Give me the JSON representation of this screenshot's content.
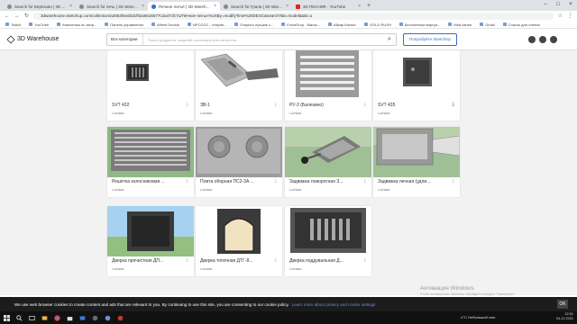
{
  "browser": {
    "tabs": [
      {
        "title": "Search for Берёзово | 3D Wareh",
        "icon": "sketchup",
        "active": false
      },
      {
        "title": "Search for печь | 3D Warehouse",
        "icon": "sketchup",
        "active": false
      },
      {
        "title": "Печное литьё | 3D Warehous",
        "icon": "sketchup",
        "active": true
      },
      {
        "title": "Search for Грали | 3D Warehouse",
        "icon": "sketchup",
        "active": false
      },
      {
        "title": "3D ПЕСНИК - YouTube",
        "icon": "youtube",
        "active": false
      }
    ],
    "new_tab": "+",
    "url": "3dwarehouse.sketchup.com/collection/a2853f4ed0d1f92a6516577c2a47cfc7u/Печное-литье?sortBy=modifyTime%20DESC&searchTab=model&tab=u",
    "bookmarks": [
      "Twitch",
      "YouTube",
      "Аналитика по запр...",
      "Панель управления",
      "Wheel Decide",
      "NPCGGC - отправ...",
      "Открыть лучшие к...",
      "ForceDrop - Магаз...",
      "Айкар Каснот",
      "GOLD RUSH",
      "Бесплатные виртуа...",
      "Мой канал",
      "Gmail",
      "Список для чтения"
    ]
  },
  "header": {
    "logo": "3D Warehouse",
    "category": "Все категории",
    "search_placeholder": "Поиск продуктов, моделей, коллекций или каталогов",
    "try_button": "Попробуйте SketchUp"
  },
  "cards": [
    {
      "title": "SVT 432",
      "author": "Luchtaar",
      "thumb": "door-small",
      "highlight": false
    },
    {
      "title": "ЗВ-1",
      "author": "Luchtaar",
      "thumb": "damper",
      "highlight": false
    },
    {
      "title": "РУ-2 (Балезино)",
      "author": "Luchtaar",
      "thumb": "grate",
      "highlight": false
    },
    {
      "title": "SVT 435",
      "author": "Luchtaar",
      "thumb": "door-square",
      "highlight": true
    },
    {
      "title": "Решётка колосниковая ...",
      "author": "Luchtaar",
      "thumb": "grate-green",
      "highlight": false
    },
    {
      "title": "Плита оборная ПС2-3А ...",
      "author": "Luchtaar",
      "thumb": "hob",
      "highlight": false
    },
    {
      "title": "Задвижка поворотная З...",
      "author": "Luchtaar",
      "thumb": "rotary",
      "highlight": false
    },
    {
      "title": "Задвижка печная (удли...",
      "author": "Luchtaar",
      "thumb": "damper-long",
      "highlight": false
    },
    {
      "title": "Дверка прочистная ДП...",
      "author": "Luchtaar",
      "thumb": "door-clean",
      "highlight": false
    },
    {
      "title": "Дверка топочная ДТГ-8...",
      "author": "Luchtaar",
      "thumb": "door-fire",
      "highlight": false
    },
    {
      "title": "Дверка поддувальная Д...",
      "author": "Luchtaar",
      "thumb": "door-ash",
      "highlight": false
    }
  ],
  "cookie": {
    "text": "We use web browser cookies to create content and ads that are relevant to you. By continuing to use this site, you are consenting to our cookie policy.",
    "link": "Learn more about privacy and cookie settings",
    "ok": "OK"
  },
  "watermark": {
    "title": "Активация Windows",
    "subtitle": "Чтобы активировать Windows, перейдите в раздел \"Параметры\"."
  },
  "taskbar": {
    "weather": "-1°C Небольшой снег",
    "time": "22:51",
    "date": "04.12.2021"
  }
}
